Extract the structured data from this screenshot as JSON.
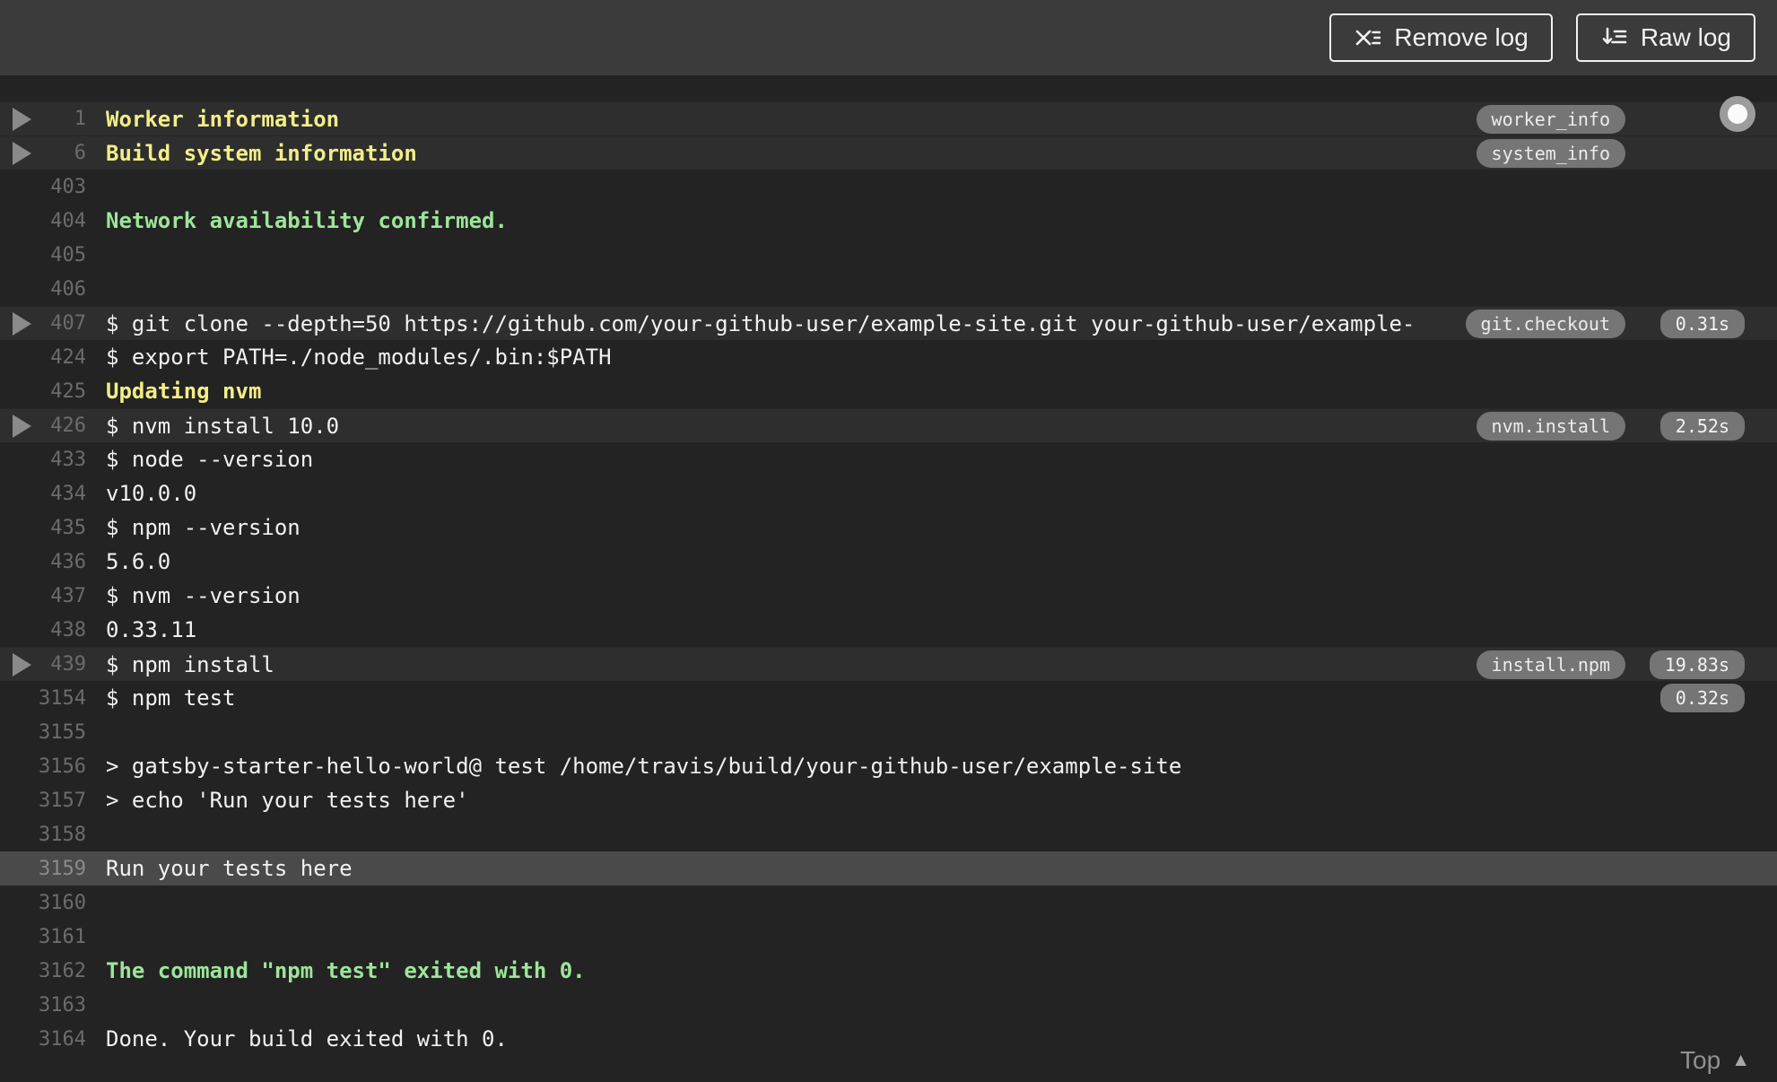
{
  "toolbar": {
    "remove_log_label": "Remove log",
    "raw_log_label": "Raw log",
    "remove_log_icon": "x-list-icon",
    "raw_log_icon": "arrow-down-list-icon"
  },
  "log": {
    "lines": [
      {
        "num": "1",
        "text": "Worker information",
        "color": "yellow",
        "row": "fold",
        "fold_arrow": true,
        "badge": "worker_info"
      },
      {
        "num": "6",
        "text": "Build system information",
        "color": "yellow",
        "row": "fold",
        "fold_arrow": true,
        "badge": "system_info"
      },
      {
        "num": "403",
        "text": ""
      },
      {
        "num": "404",
        "text": "Network availability confirmed.",
        "color": "green"
      },
      {
        "num": "405",
        "text": ""
      },
      {
        "num": "406",
        "text": ""
      },
      {
        "num": "407",
        "text": "$ git clone --depth=50 https://github.com/your-github-user/example-site.git your-github-user/example-",
        "row": "fold",
        "fold_arrow": true,
        "badge": "git.checkout",
        "time": "0.31s"
      },
      {
        "num": "424",
        "text": "$ export PATH=./node_modules/.bin:$PATH"
      },
      {
        "num": "425",
        "text": "Updating nvm",
        "color": "yellow"
      },
      {
        "num": "426",
        "text": "$ nvm install 10.0",
        "row": "fold",
        "fold_arrow": true,
        "badge": "nvm.install",
        "time": "2.52s"
      },
      {
        "num": "433",
        "text": "$ node --version"
      },
      {
        "num": "434",
        "text": "v10.0.0"
      },
      {
        "num": "435",
        "text": "$ npm --version"
      },
      {
        "num": "436",
        "text": "5.6.0"
      },
      {
        "num": "437",
        "text": "$ nvm --version"
      },
      {
        "num": "438",
        "text": "0.33.11"
      },
      {
        "num": "439",
        "text": "$ npm install",
        "row": "fold",
        "fold_arrow": true,
        "badge": "install.npm",
        "time": "19.83s"
      },
      {
        "num": "3154",
        "text": "$ npm test",
        "time": "0.32s"
      },
      {
        "num": "3155",
        "text": ""
      },
      {
        "num": "3156",
        "text": "> gatsby-starter-hello-world@ test /home/travis/build/your-github-user/example-site"
      },
      {
        "num": "3157",
        "text": "> echo 'Run your tests here'"
      },
      {
        "num": "3158",
        "text": ""
      },
      {
        "num": "3159",
        "text": "Run your tests here",
        "row": "highlight"
      },
      {
        "num": "3160",
        "text": ""
      },
      {
        "num": "3161",
        "text": ""
      },
      {
        "num": "3162",
        "text": "The command \"npm test\" exited with 0.",
        "color": "green"
      },
      {
        "num": "3163",
        "text": ""
      },
      {
        "num": "3164",
        "text": "Done. Your build exited with 0."
      }
    ],
    "top_link": {
      "label": "Top",
      "caret": "▲"
    },
    "icons": {
      "fold_arrow": "triangle-right-icon",
      "scroll_indicator": "scroll-position-dot",
      "top_caret": "caret-up-icon"
    }
  },
  "colors": {
    "header_bg": "#3b3b3b",
    "log_bg": "#232323",
    "fold_row_bg": "#2e2e2e",
    "highlight_row_bg": "#4a4a4a",
    "text": "#f1f1f1",
    "line_number": "#6c6c6c",
    "yellow": "#f2ee88",
    "green": "#9de59a",
    "badge_bg": "#757575"
  }
}
